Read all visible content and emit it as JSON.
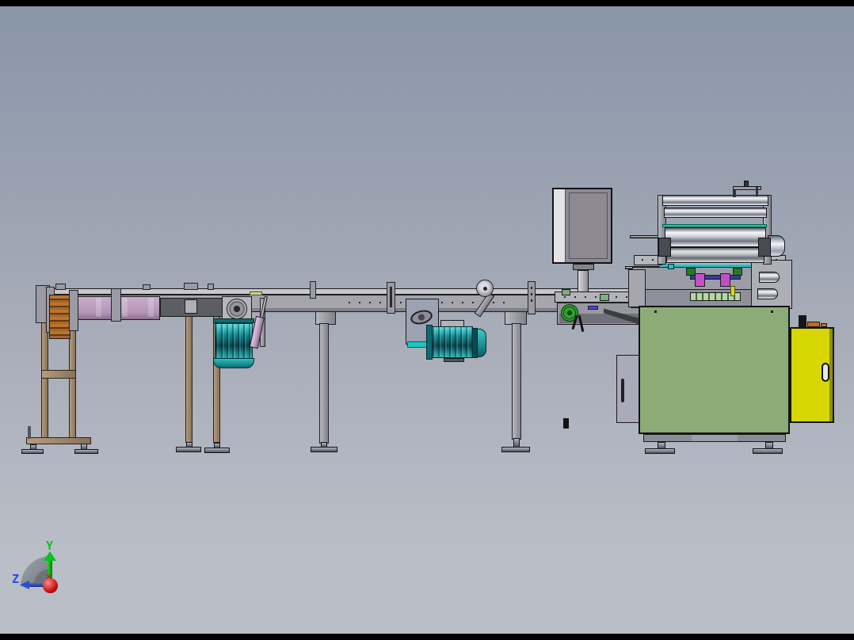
{
  "window": {
    "kind": "cad-3d-viewport",
    "scene": "packaging line machine assembly, side elevation view"
  },
  "triad": {
    "y_label": "Y",
    "z_label": "Z",
    "out_of_plane_marker": "✕"
  },
  "colors": {
    "bg-top": "#8995a9",
    "bg-mid": "#a9aeb9",
    "bg-bottom": "#babec7",
    "letterbox": "#000000",
    "outline": "#1b1b20",
    "rail": "#c7c7cc",
    "beam": "#a5a5ad",
    "frame": "#9b9ba3",
    "dark-box": "#5d5d64",
    "belt-purple": "#b394b6",
    "belt-purple-hi": "#c9aecb",
    "stack-orange": "#bc732b",
    "stack-dark": "#5e3a16",
    "leg-tan": "#a38d72",
    "motor-teal": "#14a3a8",
    "cyl-pink": "#c9a3cb",
    "sprocket-green": "#2fa230",
    "hmi-face": "#8e8a93",
    "hmi-strip": "#e3e3e3",
    "cabinet-green": "#8bac76",
    "door-yellow": "#d6d704",
    "panel-lavender": "#abaaba",
    "accent-teal": "#19c6c6",
    "accent-magenta": "#c44fc4",
    "accent-navy": "#3a3a9e",
    "accent-green": "#257a25",
    "accent-yellow": "#e2e22a",
    "pale-green": "#b7d6a5",
    "chute": "#3c3c44",
    "clamp-orange": "#bf6c22",
    "axis-y": "#00c41b",
    "axis-z": "#2750d8",
    "origin-red": "#d01818"
  }
}
